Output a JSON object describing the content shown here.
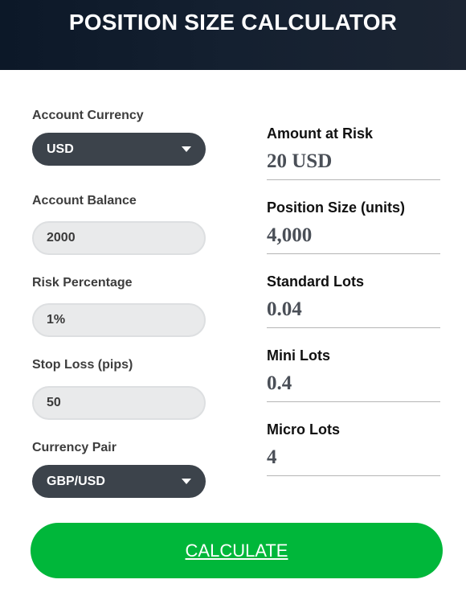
{
  "header": {
    "title": "POSITION SIZE CALCULATOR"
  },
  "form": {
    "account_currency": {
      "label": "Account Currency",
      "value": "USD"
    },
    "account_balance": {
      "label": "Account Balance",
      "value": "2000"
    },
    "risk_percentage": {
      "label": "Risk Percentage",
      "value": "1%"
    },
    "stop_loss": {
      "label": "Stop Loss (pips)",
      "value": "50"
    },
    "currency_pair": {
      "label": "Currency Pair",
      "value": "GBP/USD"
    }
  },
  "results": {
    "amount_at_risk": {
      "label": "Amount at Risk",
      "value": "20 USD"
    },
    "position_size": {
      "label": "Position Size (units)",
      "value": "4,000"
    },
    "standard_lots": {
      "label": "Standard Lots",
      "value": "0.04"
    },
    "mini_lots": {
      "label": "Mini Lots",
      "value": "0.4"
    },
    "micro_lots": {
      "label": "Micro Lots",
      "value": "4"
    }
  },
  "calculate_button": {
    "label": "CALCULATE"
  },
  "colors": {
    "accent_green": "#00b73a",
    "select_bg": "#3c434b",
    "header_bg": "#0c1828"
  }
}
